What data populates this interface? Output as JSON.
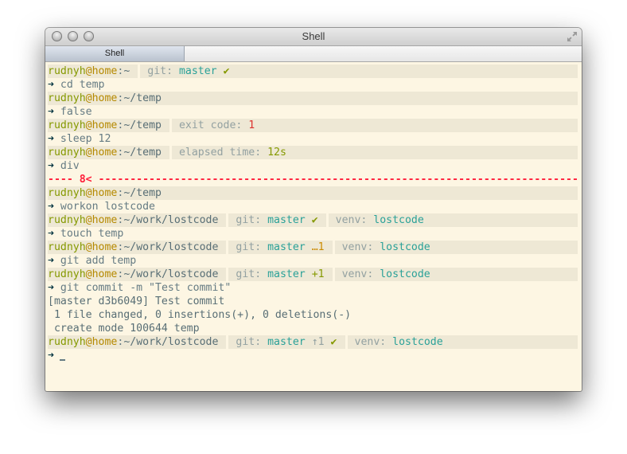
{
  "window": {
    "title": "Shell",
    "tab_label": "Shell",
    "buttons": [
      "close",
      "minimize",
      "zoom"
    ],
    "fullscreen_icon": "fullscreen-arrows-icon"
  },
  "colors": {
    "background": "#fdf6e3",
    "prompt_bar": "#eee8d5",
    "user": "#859900",
    "host": "#b58900",
    "git_branch": "#2aa198",
    "error": "#dc322f",
    "divider": "#ff1f3a"
  },
  "terminal": {
    "prompt_symbol": "➜",
    "prompts": [
      {
        "user": "rudnyh",
        "at": "@",
        "host": "home",
        "colon": ":",
        "path": "~",
        "segments": [
          {
            "label": "git: ",
            "value": "master",
            "flag": "✔",
            "flag_color": "green"
          }
        ]
      },
      {
        "user": "rudnyh",
        "at": "@",
        "host": "home",
        "colon": ":",
        "path": "~/temp",
        "segments": []
      },
      {
        "user": "rudnyh",
        "at": "@",
        "host": "home",
        "colon": ":",
        "path": "~/temp",
        "segments": [
          {
            "label": "exit code: ",
            "value": "1",
            "value_color": "red"
          }
        ]
      },
      {
        "user": "rudnyh",
        "at": "@",
        "host": "home",
        "colon": ":",
        "path": "~/temp",
        "segments": [
          {
            "label": "elapsed time: ",
            "value": "12s",
            "value_color": "green"
          }
        ]
      },
      {
        "user": "rudnyh",
        "at": "@",
        "host": "home",
        "colon": ":",
        "path": "~/temp",
        "segments": []
      },
      {
        "user": "rudnyh",
        "at": "@",
        "host": "home",
        "colon": ":",
        "path": "~/work/lostcode",
        "segments": [
          {
            "label": "git: ",
            "value": "master",
            "flag": "✔",
            "flag_color": "green"
          },
          {
            "label": "venv: ",
            "value": "lostcode"
          }
        ]
      },
      {
        "user": "rudnyh",
        "at": "@",
        "host": "home",
        "colon": ":",
        "path": "~/work/lostcode",
        "segments": [
          {
            "label": "git: ",
            "value": "master",
            "flag": "…1",
            "flag_color": "orange"
          },
          {
            "label": "venv: ",
            "value": "lostcode"
          }
        ]
      },
      {
        "user": "rudnyh",
        "at": "@",
        "host": "home",
        "colon": ":",
        "path": "~/work/lostcode",
        "segments": [
          {
            "label": "git: ",
            "value": "master",
            "flag": "+1",
            "flag_color": "green"
          },
          {
            "label": "venv: ",
            "value": "lostcode"
          }
        ]
      },
      {
        "user": "rudnyh",
        "at": "@",
        "host": "home",
        "colon": ":",
        "path": "~/work/lostcode",
        "segments": [
          {
            "label": "git: ",
            "value": "master",
            "flag": "↑1",
            "flag2": "✔",
            "flag_color": "dim"
          },
          {
            "label": "venv: ",
            "value": "lostcode"
          }
        ]
      }
    ],
    "commands": [
      "cd temp",
      "false",
      "sleep 12",
      "div",
      "workon lostcode",
      "touch temp",
      "git add temp",
      "git commit -m \"Test commit\"",
      ""
    ],
    "divider": {
      "left": "---- ",
      "marker": "8<",
      "right": " --------------------------------------------------------------------------------"
    },
    "commit_output": [
      "[master d3b6049] Test commit",
      " 1 file changed, 0 insertions(+), 0 deletions(-)",
      " create mode 100644 temp"
    ]
  }
}
